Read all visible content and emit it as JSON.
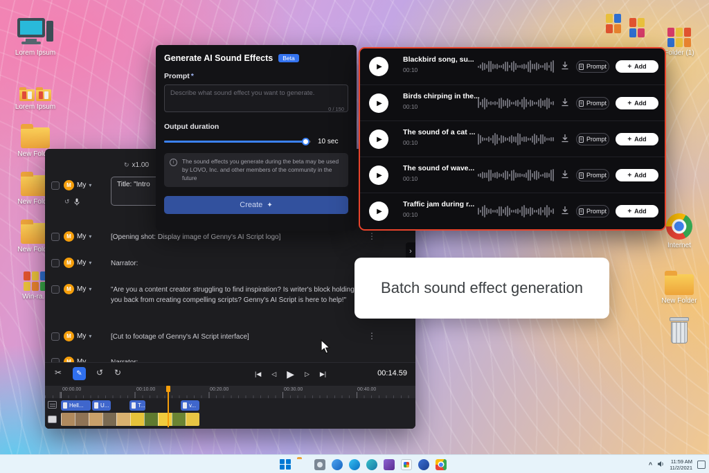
{
  "icons": {
    "plus": "+",
    "kebab": "⋮",
    "caret_down": "▾",
    "play": "▶",
    "to_start": "|◀",
    "frame_back": "◁",
    "frame_fwd": "▷",
    "to_end": "▶|",
    "undo": "↺",
    "redo": "↻",
    "scissors": "✂",
    "pencil": "✎",
    "sparkle": "✦",
    "info": "i",
    "chevron_right": "›",
    "chevron_up": "^",
    "zoom_reset": "↻",
    "mic": "🎙"
  },
  "colors": {
    "accent_blue": "#3b82f6",
    "create_blue": "#32519e",
    "results_border_red": "#e8432b",
    "playhead_orange": "#f59e0b",
    "avatar_orange": "#f59e0b"
  },
  "desktop": {
    "icons_left": [
      {
        "label": "Lorem Ipsum",
        "type": "computer"
      },
      {
        "label": "Lorem Ipsum",
        "type": "folders"
      },
      {
        "label": "New Folder",
        "type": "folder"
      },
      {
        "label": "New Folder",
        "type": "folder"
      },
      {
        "label": "New Folder",
        "type": "folder"
      },
      {
        "label": "Win-ra...",
        "type": "archive"
      }
    ],
    "icons_right": [
      {
        "label": "Folder (1)",
        "type": "archive"
      },
      {
        "label": "Internet",
        "type": "chrome"
      },
      {
        "label": "New Folder",
        "type": "folder"
      },
      {
        "label": "",
        "type": "recycle-bin"
      }
    ]
  },
  "sfx_panel": {
    "title": "Generate AI Sound Effects",
    "beta_badge": "Beta",
    "prompt_label": "Prompt",
    "required_mark": "*",
    "prompt_placeholder": "Describe what sound effect you want to generate.",
    "char_counter": "0 / 150",
    "duration_label": "Output duration",
    "duration_value": "10 sec",
    "beta_notice": "The sound effects you generate during the beta may be used by LOVO, Inc. and other members of the community in the future",
    "create_button": "Create"
  },
  "results_panel": {
    "prompt_button": "Prompt",
    "add_button": "Add",
    "items": [
      {
        "title": "Blackbird song, su...",
        "duration": "00:10"
      },
      {
        "title": "Birds chirping in the...",
        "duration": "00:10"
      },
      {
        "title": "The sound of a cat ...",
        "duration": "00:10"
      },
      {
        "title": "The sound of wave...",
        "duration": "00:10"
      },
      {
        "title": "Traffic jam during r...",
        "duration": "00:10"
      }
    ]
  },
  "script_editor": {
    "zoom": "x1.00",
    "rows": [
      {
        "initial": "M",
        "speaker": "My",
        "text": "Title: \"Intro"
      },
      {
        "initial": "M",
        "speaker": "My",
        "text": "[Opening shot: Display image of Genny's AI Script logo]"
      },
      {
        "initial": "M",
        "speaker": "My",
        "text": "Narrator:"
      },
      {
        "initial": "M",
        "speaker": "My",
        "text": "\"Are you a content creator struggling to find inspiration? Is writer's block holding you back from creating compelling scripts? Genny's AI Script is here to help!\""
      },
      {
        "initial": "M",
        "speaker": "My",
        "text": "[Cut to footage of Genny's AI Script interface]"
      },
      {
        "initial": "M",
        "speaker": "My",
        "text": "Narrator:"
      }
    ]
  },
  "timeline": {
    "current_time": "00:14.59",
    "ruler": [
      "00:00.00",
      "00:10.00",
      "00:20.00",
      "00:30.00",
      "00:40.00"
    ],
    "clips": [
      "Hell...",
      "U...",
      "T...",
      "v..."
    ]
  },
  "tooltip": "Batch sound effect generation",
  "taskbar": {
    "time": "11:59 AM",
    "date": "11/2/2021"
  }
}
